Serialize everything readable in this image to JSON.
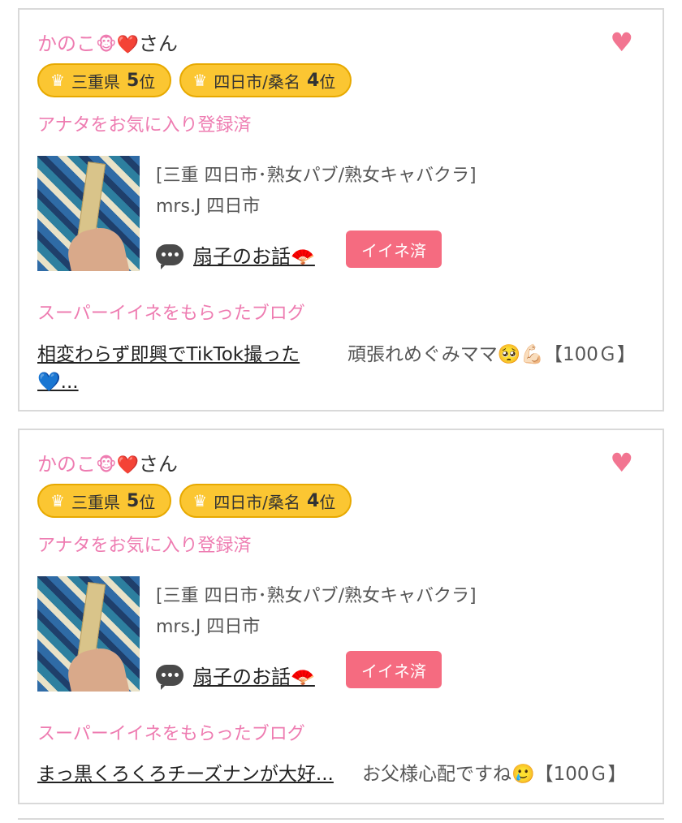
{
  "cards": [
    {
      "name": "かのこ",
      "name_emoji": "🐵❤️",
      "name_suffix": "さん",
      "heart_icon": "♥",
      "badge1": {
        "crown": "♛",
        "area": "三重県",
        "rank": "5",
        "unit": "位"
      },
      "badge2": {
        "crown": "♛",
        "area": "四日市/桑名",
        "rank": "4",
        "unit": "位"
      },
      "favorite_status": "アナタをお気に入り登録済",
      "category": "[三重 四日市･熟女パブ/熟女キャバクラ]",
      "shop": "mrs.J 四日市",
      "blog_title": "扇子のお話🪭",
      "like_label": "イイネ済",
      "super_label": "スーパーイイネをもらったブログ",
      "super_post": "相変わらず即興でTikTok撮った💙...",
      "super_comment": "頑張れめぐみママ🥺💪🏻【100Ｇ】"
    },
    {
      "name": "かのこ",
      "name_emoji": "🐵❤️",
      "name_suffix": "さん",
      "heart_icon": "♥",
      "badge1": {
        "crown": "♛",
        "area": "三重県",
        "rank": "5",
        "unit": "位"
      },
      "badge2": {
        "crown": "♛",
        "area": "四日市/桑名",
        "rank": "4",
        "unit": "位"
      },
      "favorite_status": "アナタをお気に入り登録済",
      "category": "[三重 四日市･熟女パブ/熟女キャバクラ]",
      "shop": "mrs.J 四日市",
      "blog_title": "扇子のお話🪭",
      "like_label": "イイネ済",
      "super_label": "スーパーイイネをもらったブログ",
      "super_post": "まっ黒くろくろチーズナンが大好...",
      "super_comment": "お父様心配ですね🥲【100Ｇ】"
    }
  ]
}
